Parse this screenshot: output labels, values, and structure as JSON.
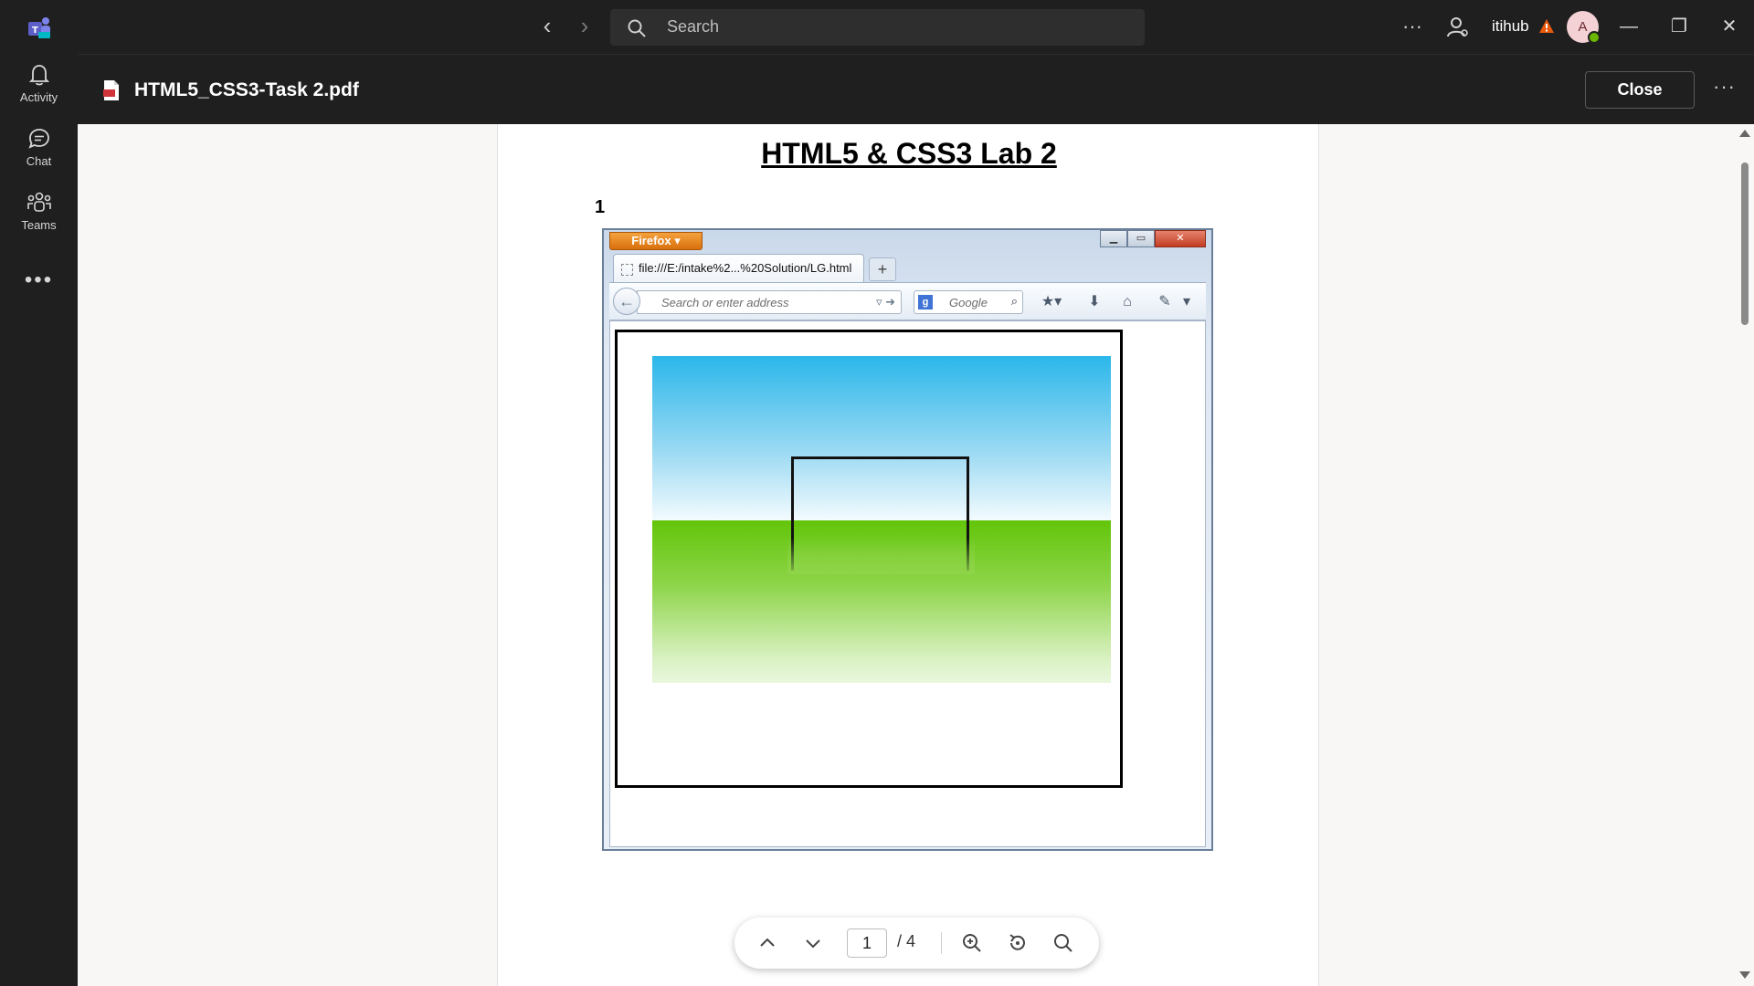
{
  "titlebar": {
    "search_placeholder": "Search",
    "username": "itihub",
    "avatar_initial": "A",
    "icons": [
      "teams-logo-icon",
      "back-arrow-icon",
      "forward-arrow-icon",
      "more-icon",
      "people-icon",
      "warning-icon",
      "minimize-icon",
      "restore-icon",
      "close-icon"
    ]
  },
  "rail": {
    "items": [
      {
        "label": "Activity",
        "icon": "bell-icon"
      },
      {
        "label": "Chat",
        "icon": "chat-icon"
      },
      {
        "label": "Teams",
        "icon": "teams-icon"
      }
    ],
    "more_label": "•••"
  },
  "filebar": {
    "file_name": "HTML5_CSS3-Task 2.pdf",
    "close_label": "Close",
    "more_label": "···"
  },
  "document": {
    "title": "HTML5 & CSS3 Lab 2",
    "number": "1",
    "browser": {
      "menu_label": "Firefox",
      "tab_title": "file:///E:/intake%2...%20Solution/LG.html",
      "address_placeholder": "Search or enter address",
      "search_engine_placeholder": "Google"
    }
  },
  "pdf_toolbar": {
    "current_page": "1",
    "total_pages": "/ 4"
  },
  "colors": {
    "chrome_dark": "#1f1f1f",
    "page_bg": "#f8f7f6",
    "sky_top": "#2bb7ea",
    "grass_top": "#63c50a",
    "firefox_orange": "#e8851f"
  }
}
